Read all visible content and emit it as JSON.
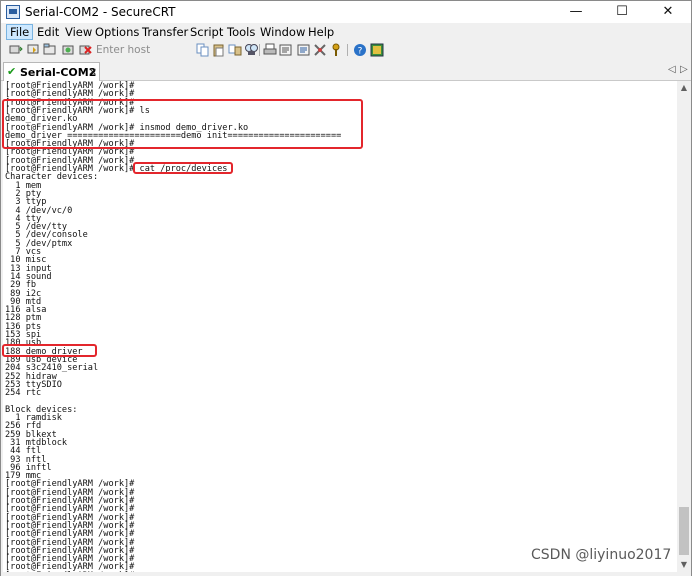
{
  "window": {
    "title": "Serial-COM2 - SecureCRT",
    "minimize_glyph": "—",
    "maximize_glyph": "☐",
    "close_glyph": "✕"
  },
  "menu": {
    "items": [
      "File",
      "Edit",
      "View",
      "Options",
      "Transfer",
      "Script",
      "Tools",
      "Window",
      "Help"
    ]
  },
  "toolbar": {
    "host_placeholder": "Enter host <Alt+R>",
    "icons": [
      "connect-icon",
      "quick-connect-icon",
      "connect-tab-icon",
      "reconnect-icon",
      "disconnect-icon",
      "copy-icon",
      "paste-icon",
      "copy-paste-icon",
      "find-icon",
      "print-icon",
      "session-options-icon",
      "global-options-icon",
      "sftp-icon",
      "keymap-icon",
      "help-icon",
      "screenshot-icon"
    ]
  },
  "tab": {
    "label": "Serial-COM2",
    "close_glyph": "×",
    "check_glyph": "✔",
    "nav_left": "◁",
    "nav_right": "▷"
  },
  "terminal": {
    "lines": [
      "[root@FriendlyARM /work]#",
      "[root@FriendlyARM /work]#",
      "[root@FriendlyARM /work]#",
      "[root@FriendlyARM /work]# ls",
      "demo_driver.ko",
      "[root@FriendlyARM /work]# insmod demo_driver.ko",
      "demo_driver ======================demo init======================",
      "[root@FriendlyARM /work]#",
      "[root@FriendlyARM /work]#",
      "[root@FriendlyARM /work]#",
      "[root@FriendlyARM /work]# cat /proc/devices",
      "Character devices:",
      "  1 mem",
      "  2 pty",
      "  3 ttyp",
      "  4 /dev/vc/0",
      "  4 tty",
      "  5 /dev/tty",
      "  5 /dev/console",
      "  5 /dev/ptmx",
      "  7 vcs",
      " 10 misc",
      " 13 input",
      " 14 sound",
      " 29 fb",
      " 89 i2c",
      " 90 mtd",
      "116 alsa",
      "128 ptm",
      "136 pts",
      "153 spi",
      "180 usb",
      "188 demo_driver",
      "189 usb_device",
      "204 s3c2410_serial",
      "252 hidraw",
      "253 ttySDIO",
      "254 rtc",
      "",
      "Block devices:",
      "  1 ramdisk",
      "256 rfd",
      "259 blkext",
      " 31 mtdblock",
      " 44 ftl",
      " 93 nftl",
      " 96 inftl",
      "179 mmc",
      "[root@FriendlyARM /work]#",
      "[root@FriendlyARM /work]#",
      "[root@FriendlyARM /work]#",
      "[root@FriendlyARM /work]#",
      "[root@FriendlyARM /work]#",
      "[root@FriendlyARM /work]#",
      "[root@FriendlyARM /work]#",
      "[root@FriendlyARM /work]#",
      "[root@FriendlyARM /work]#",
      "[root@FriendlyARM /work]#",
      "[root@FriendlyARM /work]#",
      "[root@FriendlyARM /work]#"
    ]
  },
  "scrollbar": {
    "up_glyph": "▲",
    "down_glyph": "▼"
  },
  "watermark": "CSDN @liyinuo2017",
  "colors": {
    "highlight": "#e3262c",
    "terminal_bg": "#ffffff",
    "terminal_text": "#111111"
  }
}
